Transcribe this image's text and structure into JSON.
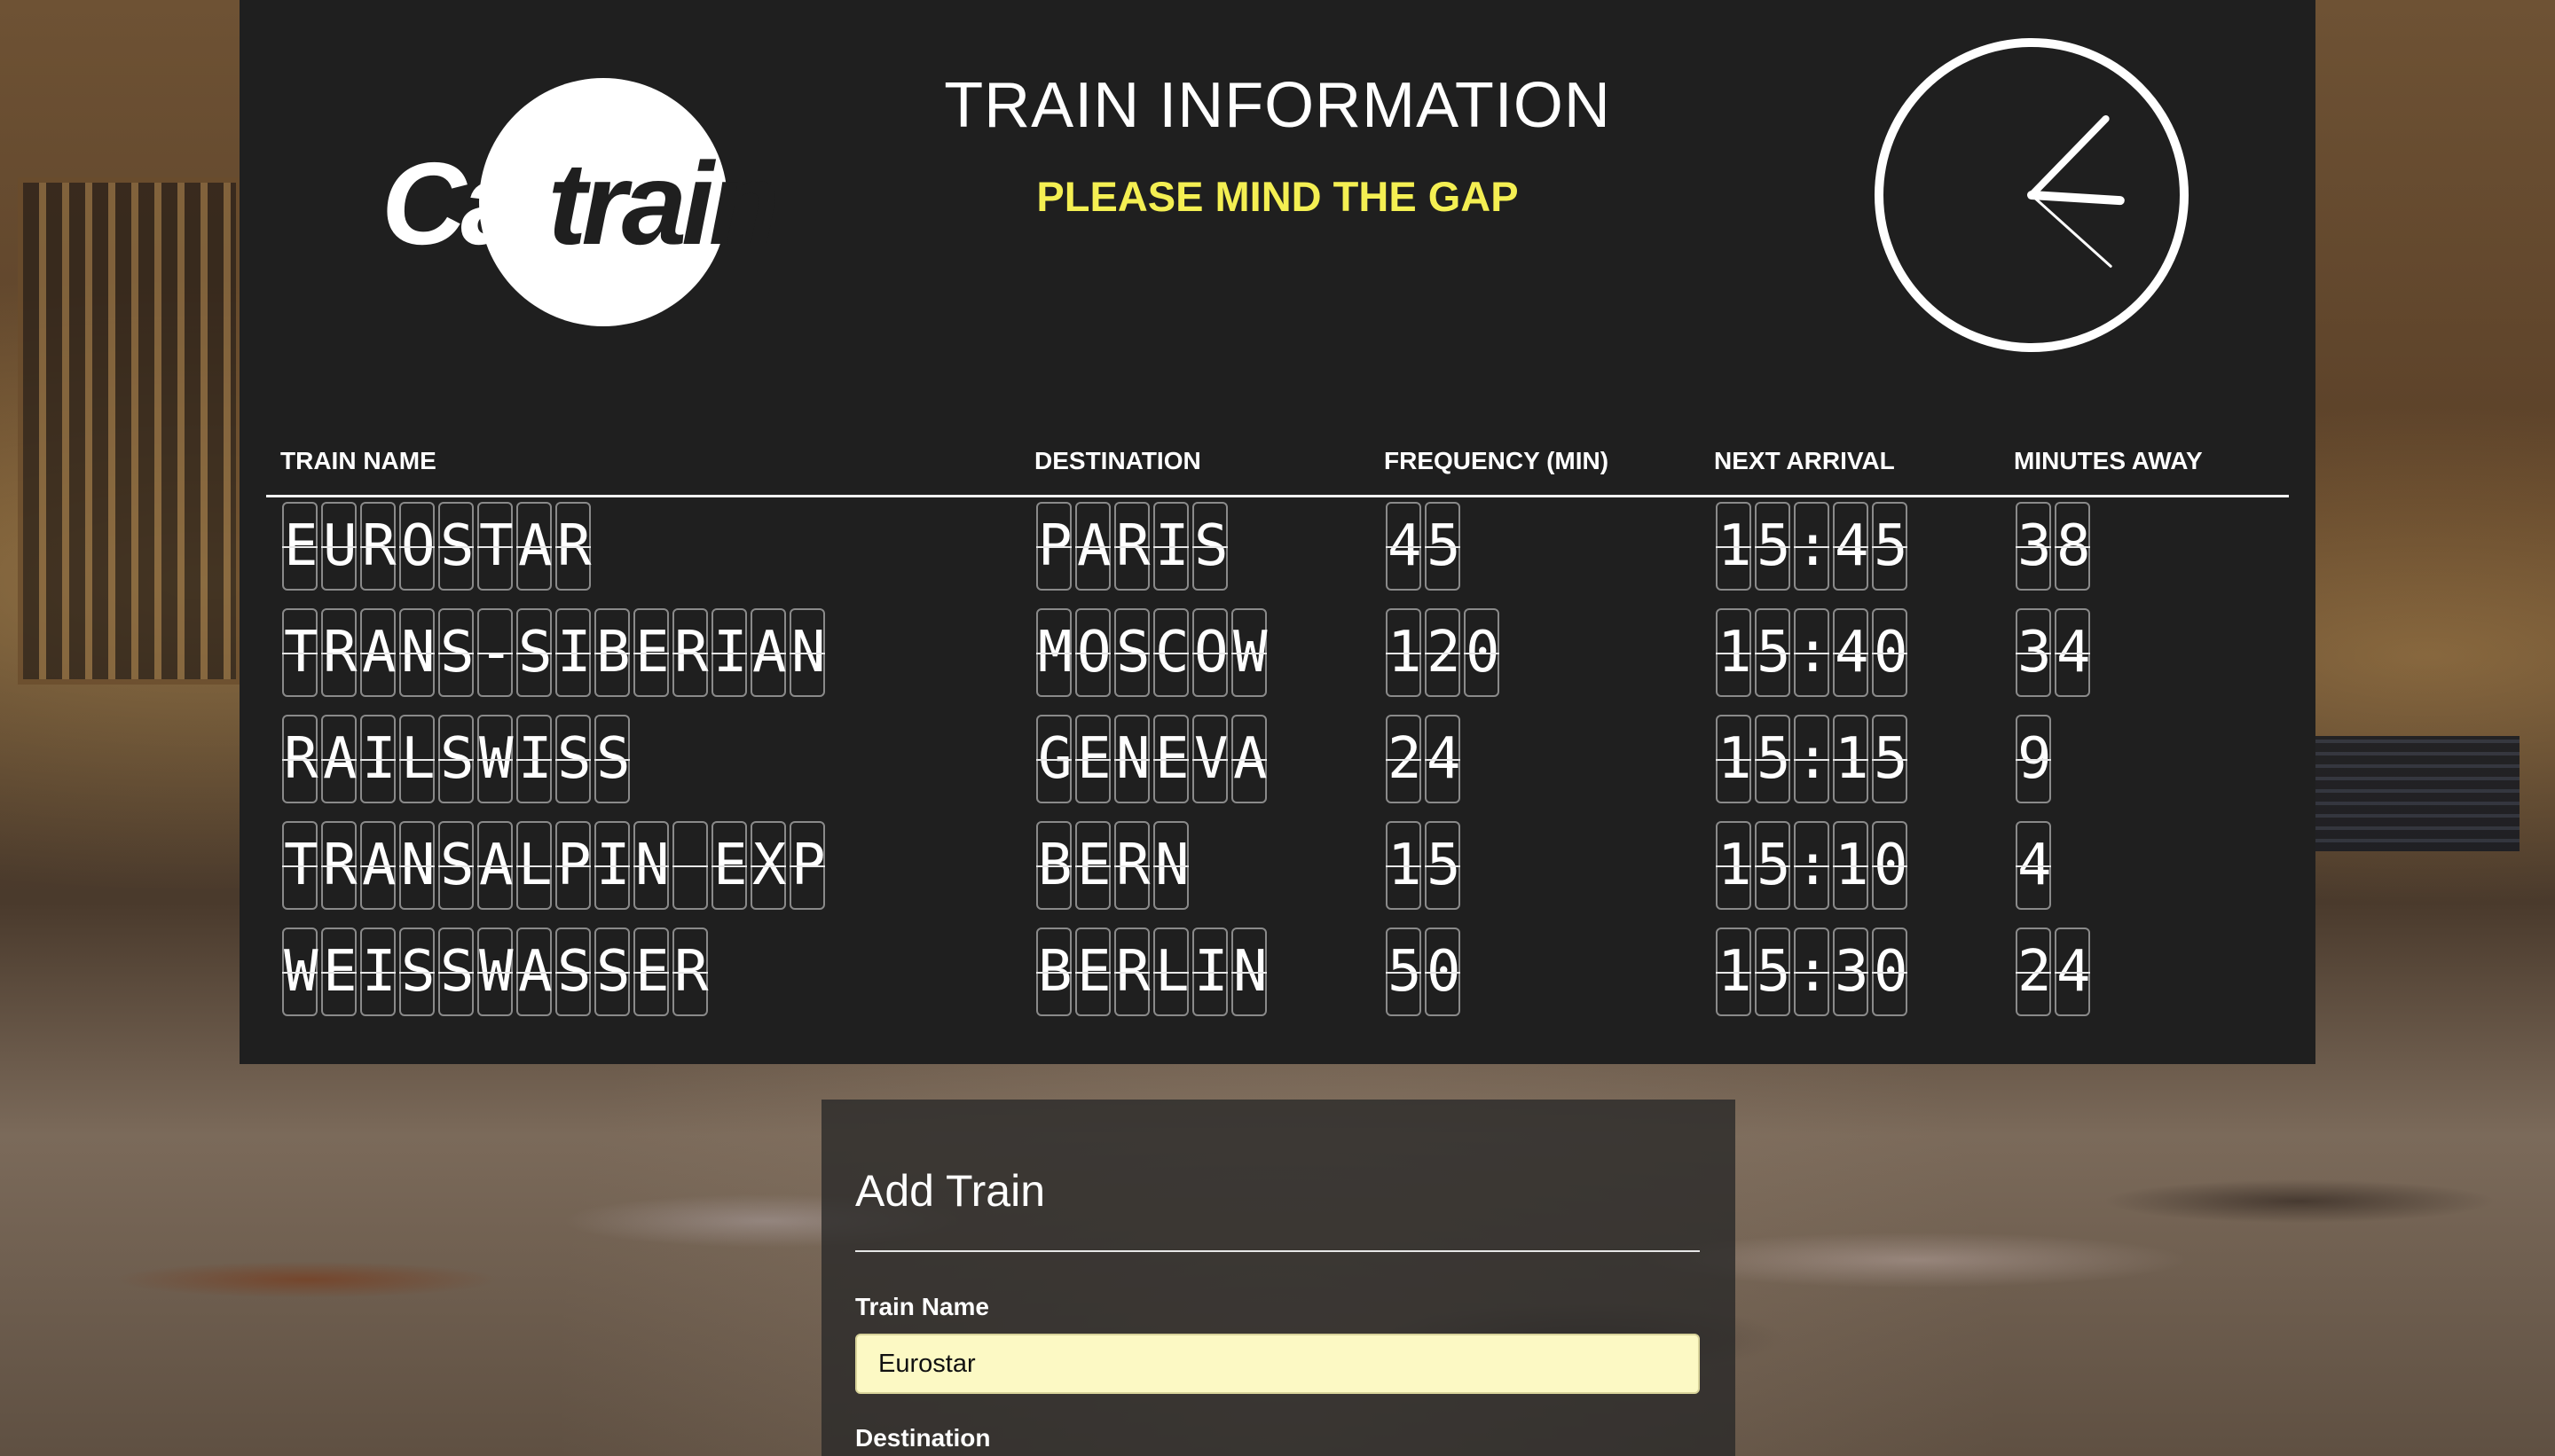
{
  "header": {
    "logo_text_cal": "Cal",
    "logo_text_train": "train",
    "title": "TRAIN INFORMATION",
    "subtitle": "PLEASE MIND THE GAP"
  },
  "clock": {
    "hour": 3,
    "minute": 7,
    "second": 22,
    "color": "#ffffff"
  },
  "table": {
    "columns": [
      "TRAIN NAME",
      "DESTINATION",
      "FREQUENCY (MIN)",
      "NEXT ARRIVAL",
      "MINUTES AWAY"
    ],
    "rows": [
      [
        "EUROSTAR",
        "PARIS",
        "45",
        "15:45",
        "38"
      ],
      [
        "TRANS-SIBERIAN",
        "MOSCOW",
        "120",
        "15:40",
        "34"
      ],
      [
        "RAILSWISS",
        "GENEVA",
        "24",
        "15:15",
        "9"
      ],
      [
        "TRANSALPIN EXP",
        "BERN",
        "15",
        "15:10",
        "4"
      ],
      [
        "WEISSWASSER",
        "BERLIN",
        "50",
        "15:30",
        "24"
      ]
    ]
  },
  "form": {
    "title": "Add Train",
    "train_name_label": "Train Name",
    "train_name_value": "Eurostar",
    "destination_label": "Destination"
  },
  "colors": {
    "board_bg": "#1f1f1f",
    "accent_yellow": "#f4ef52",
    "input_bg": "#fcf9c4"
  }
}
